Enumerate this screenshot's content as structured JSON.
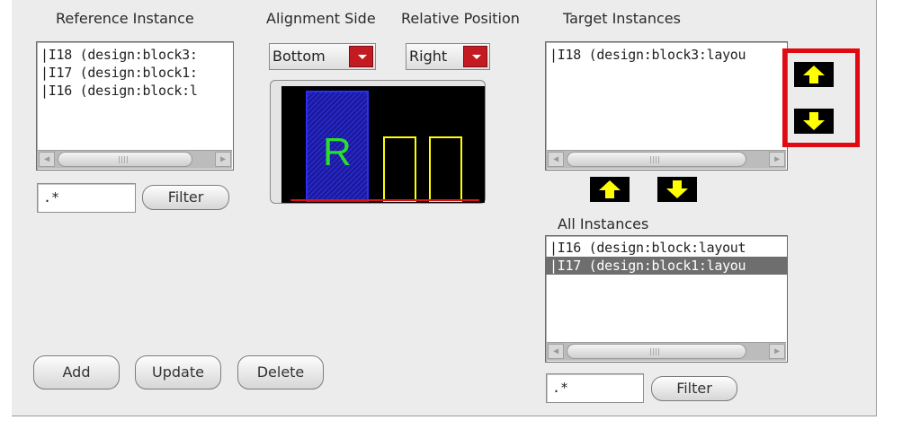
{
  "headers": {
    "reference": "Reference Instance",
    "alignment": "Alignment Side",
    "relative": "Relative Position",
    "target": "Target Instances",
    "all": "All Instances"
  },
  "reference_list": [
    "|I18 (design:block3:",
    "|I17 (design:block1:",
    "|I16 (design:block:l"
  ],
  "reference_filter": {
    "value": ".*",
    "button": "Filter"
  },
  "alignment_side": {
    "selected": "Bottom"
  },
  "relative_position": {
    "selected": "Right"
  },
  "preview": {
    "label": "R"
  },
  "target_list": [
    "|I18 (design:block3:layou"
  ],
  "all_instances_list": [
    {
      "text": "|I16 (design:block:layout",
      "selected": false
    },
    {
      "text": "|I17 (design:block1:layou",
      "selected": true
    }
  ],
  "all_filter": {
    "value": ".*",
    "button": "Filter"
  },
  "buttons": {
    "add": "Add",
    "update": "Update",
    "delete": "Delete"
  },
  "icons": {
    "move_up": "arrow-up-icon",
    "move_down": "arrow-down-icon",
    "add_to_target": "arrow-up-icon",
    "remove_from_target": "arrow-down-icon"
  },
  "colors": {
    "arrow": "#ffff00",
    "highlight": "#e20a12",
    "dropdown": "#c41a22"
  }
}
